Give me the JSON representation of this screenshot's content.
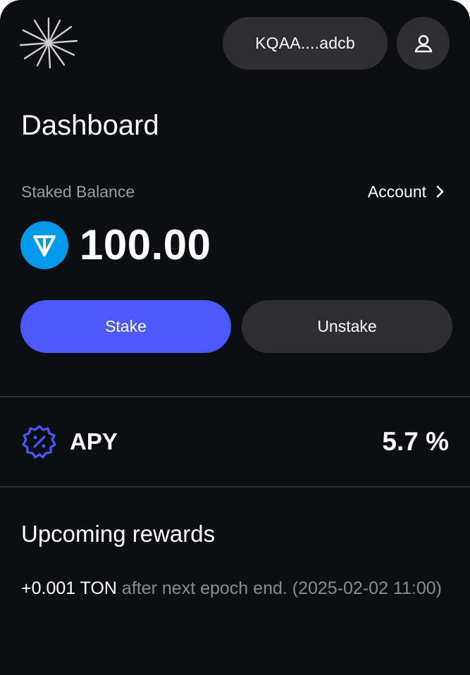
{
  "header": {
    "logo_icon": "sunburst-logo-icon",
    "wallet_address": "KQAA....adcb",
    "profile_icon": "user-icon"
  },
  "page_title": "Dashboard",
  "balance": {
    "label": "Staked Balance",
    "account_link": "Account",
    "token_icon": "ton-icon",
    "value": "100.00"
  },
  "actions": {
    "stake": "Stake",
    "unstake": "Unstake"
  },
  "apy": {
    "icon": "percent-badge-icon",
    "label": "APY",
    "value": "5.7 %"
  },
  "rewards": {
    "title": "Upcoming rewards",
    "amount": "+0.001 TON",
    "description": " after next epoch end. (2025-02-02 11:00)"
  },
  "colors": {
    "background": "#0d0e12",
    "accent": "#4b57ff",
    "surface": "#2e2e32",
    "ton_blue": "#0098ea",
    "muted_text": "#9a9ba0"
  }
}
